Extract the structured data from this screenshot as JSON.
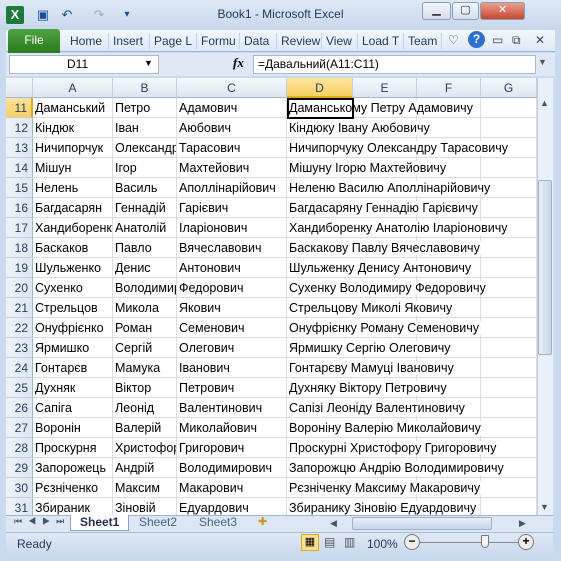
{
  "window": {
    "title": "Book1  -  Microsoft Excel"
  },
  "quick_access": {
    "icons": [
      "excel-logo-icon",
      "save-icon",
      "undo-icon",
      "redo-icon",
      "customize-icon"
    ]
  },
  "ribbon": {
    "file_label": "File",
    "tabs": [
      "Home",
      "Insert",
      "Page L",
      "Formu",
      "Data",
      "Review",
      "View",
      "Load T",
      "Team"
    ]
  },
  "formula_bar": {
    "name_box": "D11",
    "fx": "fx",
    "formula": "=Давальний(A11:C11)"
  },
  "columns": [
    "A",
    "B",
    "C",
    "D",
    "E",
    "F",
    "G"
  ],
  "selected": {
    "column": "D",
    "row": "11"
  },
  "rows": [
    {
      "n": "11",
      "a": "Даманський",
      "b": "Петро",
      "c": "Адамович",
      "d": "Даманському Петру Адамовичу"
    },
    {
      "n": "12",
      "a": "Кіндюк",
      "b": "Іван",
      "c": "Аюбович",
      "d": "Кіндюку Івану Аюбовичу"
    },
    {
      "n": "13",
      "a": "Ничипорчук",
      "b": "Олександр",
      "c": "Тарасович",
      "d": "Ничипорчуку Олександру Тарасовичу"
    },
    {
      "n": "14",
      "a": "Мішун",
      "b": "Ігор",
      "c": "Махтейович",
      "d": "Мішуну Ігорю Махтейовичу"
    },
    {
      "n": "15",
      "a": "Нелень",
      "b": "Василь",
      "c": "Аполлінарійович",
      "d": "Неленю Василю Аполлінарійовичу"
    },
    {
      "n": "16",
      "a": "Багдасарян",
      "b": "Геннадій",
      "c": "Гарієвич",
      "d": "Багдасаряну Геннадію Гарієвичу"
    },
    {
      "n": "17",
      "a": "Хандиборенко",
      "b": "Анатолій",
      "c": "Іларіонович",
      "d": "Хандиборенку Анатолію Іларіоновичу"
    },
    {
      "n": "18",
      "a": "Баскаков",
      "b": "Павло",
      "c": "Вячеславович",
      "d": "Баскакову Павлу Вячеславовичу"
    },
    {
      "n": "19",
      "a": "Шульженко",
      "b": "Денис",
      "c": "Антонович",
      "d": "Шульженку Денису Антоновичу"
    },
    {
      "n": "20",
      "a": "Сухенко",
      "b": "Володимир",
      "c": "Федорович",
      "d": "Сухенку Володимиру Федоровичу"
    },
    {
      "n": "21",
      "a": "Стрельцов",
      "b": "Микола",
      "c": "Якович",
      "d": "Стрельцову Миколі Яковичу"
    },
    {
      "n": "22",
      "a": "Онуфрієнко",
      "b": "Роман",
      "c": "Семенович",
      "d": "Онуфрієнку Роману Семеновичу"
    },
    {
      "n": "23",
      "a": "Ярмишко",
      "b": "Сергій",
      "c": "Олегович",
      "d": "Ярмишку Сергію Олеговичу"
    },
    {
      "n": "24",
      "a": "Гонтарєв",
      "b": "Мамука",
      "c": "Іванович",
      "d": "Гонтарєву Мамуці Івановичу"
    },
    {
      "n": "25",
      "a": "Духняк",
      "b": "Віктор",
      "c": "Петрович",
      "d": "Духняку Віктору Петровичу"
    },
    {
      "n": "26",
      "a": "Сапіга",
      "b": "Леонід",
      "c": "Валентинович",
      "d": "Сапізі Леоніду Валентиновичу"
    },
    {
      "n": "27",
      "a": "Воронін",
      "b": "Валерій",
      "c": "Миколайович",
      "d": "Вороніну Валерію Миколайовичу"
    },
    {
      "n": "28",
      "a": "Проскурня",
      "b": "Христофор",
      "c": "Григорович",
      "d": "Проскурні Христофору Григоровичу"
    },
    {
      "n": "29",
      "a": "Запорожець",
      "b": "Андрій",
      "c": "Володимирович",
      "d": "Запорожцю Андрію Володимировичу"
    },
    {
      "n": "30",
      "a": "Рєзніченко",
      "b": "Максим",
      "c": "Макарович",
      "d": "Рєзніченку Максиму Макаровичу"
    },
    {
      "n": "31",
      "a": "Збираник",
      "b": "Зіновій",
      "c": "Едуардович",
      "d": "Збиранику Зіновію Едуардовичу"
    }
  ],
  "sheets": [
    "Sheet1",
    "Sheet2",
    "Sheet3"
  ],
  "active_sheet": "Sheet1",
  "status": {
    "text": "Ready",
    "zoom": "100%",
    "zoom_percent": 100
  }
}
